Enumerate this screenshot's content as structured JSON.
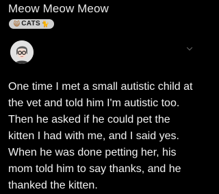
{
  "header": {
    "title": "Meow Meow Meow",
    "flair": {
      "label": "CATS",
      "left_icon": "cat-face-icon",
      "right_icon": "cat-icon"
    }
  },
  "post": {
    "avatar_icon": "avatar",
    "menu_icon": "chevron-down-icon",
    "lines": [
      "One time I met a small autistic child at",
      "the vet and told him I'm autistic too.",
      "Then he asked if he could pet the",
      "kitten I had with me, and I said yes.",
      "When he was done petting her, his",
      "mom told him to say thanks, and he",
      "thanked the kitten."
    ]
  },
  "colors": {
    "background": "#000000",
    "text": "#f2f2f2",
    "flair_bg": "#cfcfcf"
  }
}
